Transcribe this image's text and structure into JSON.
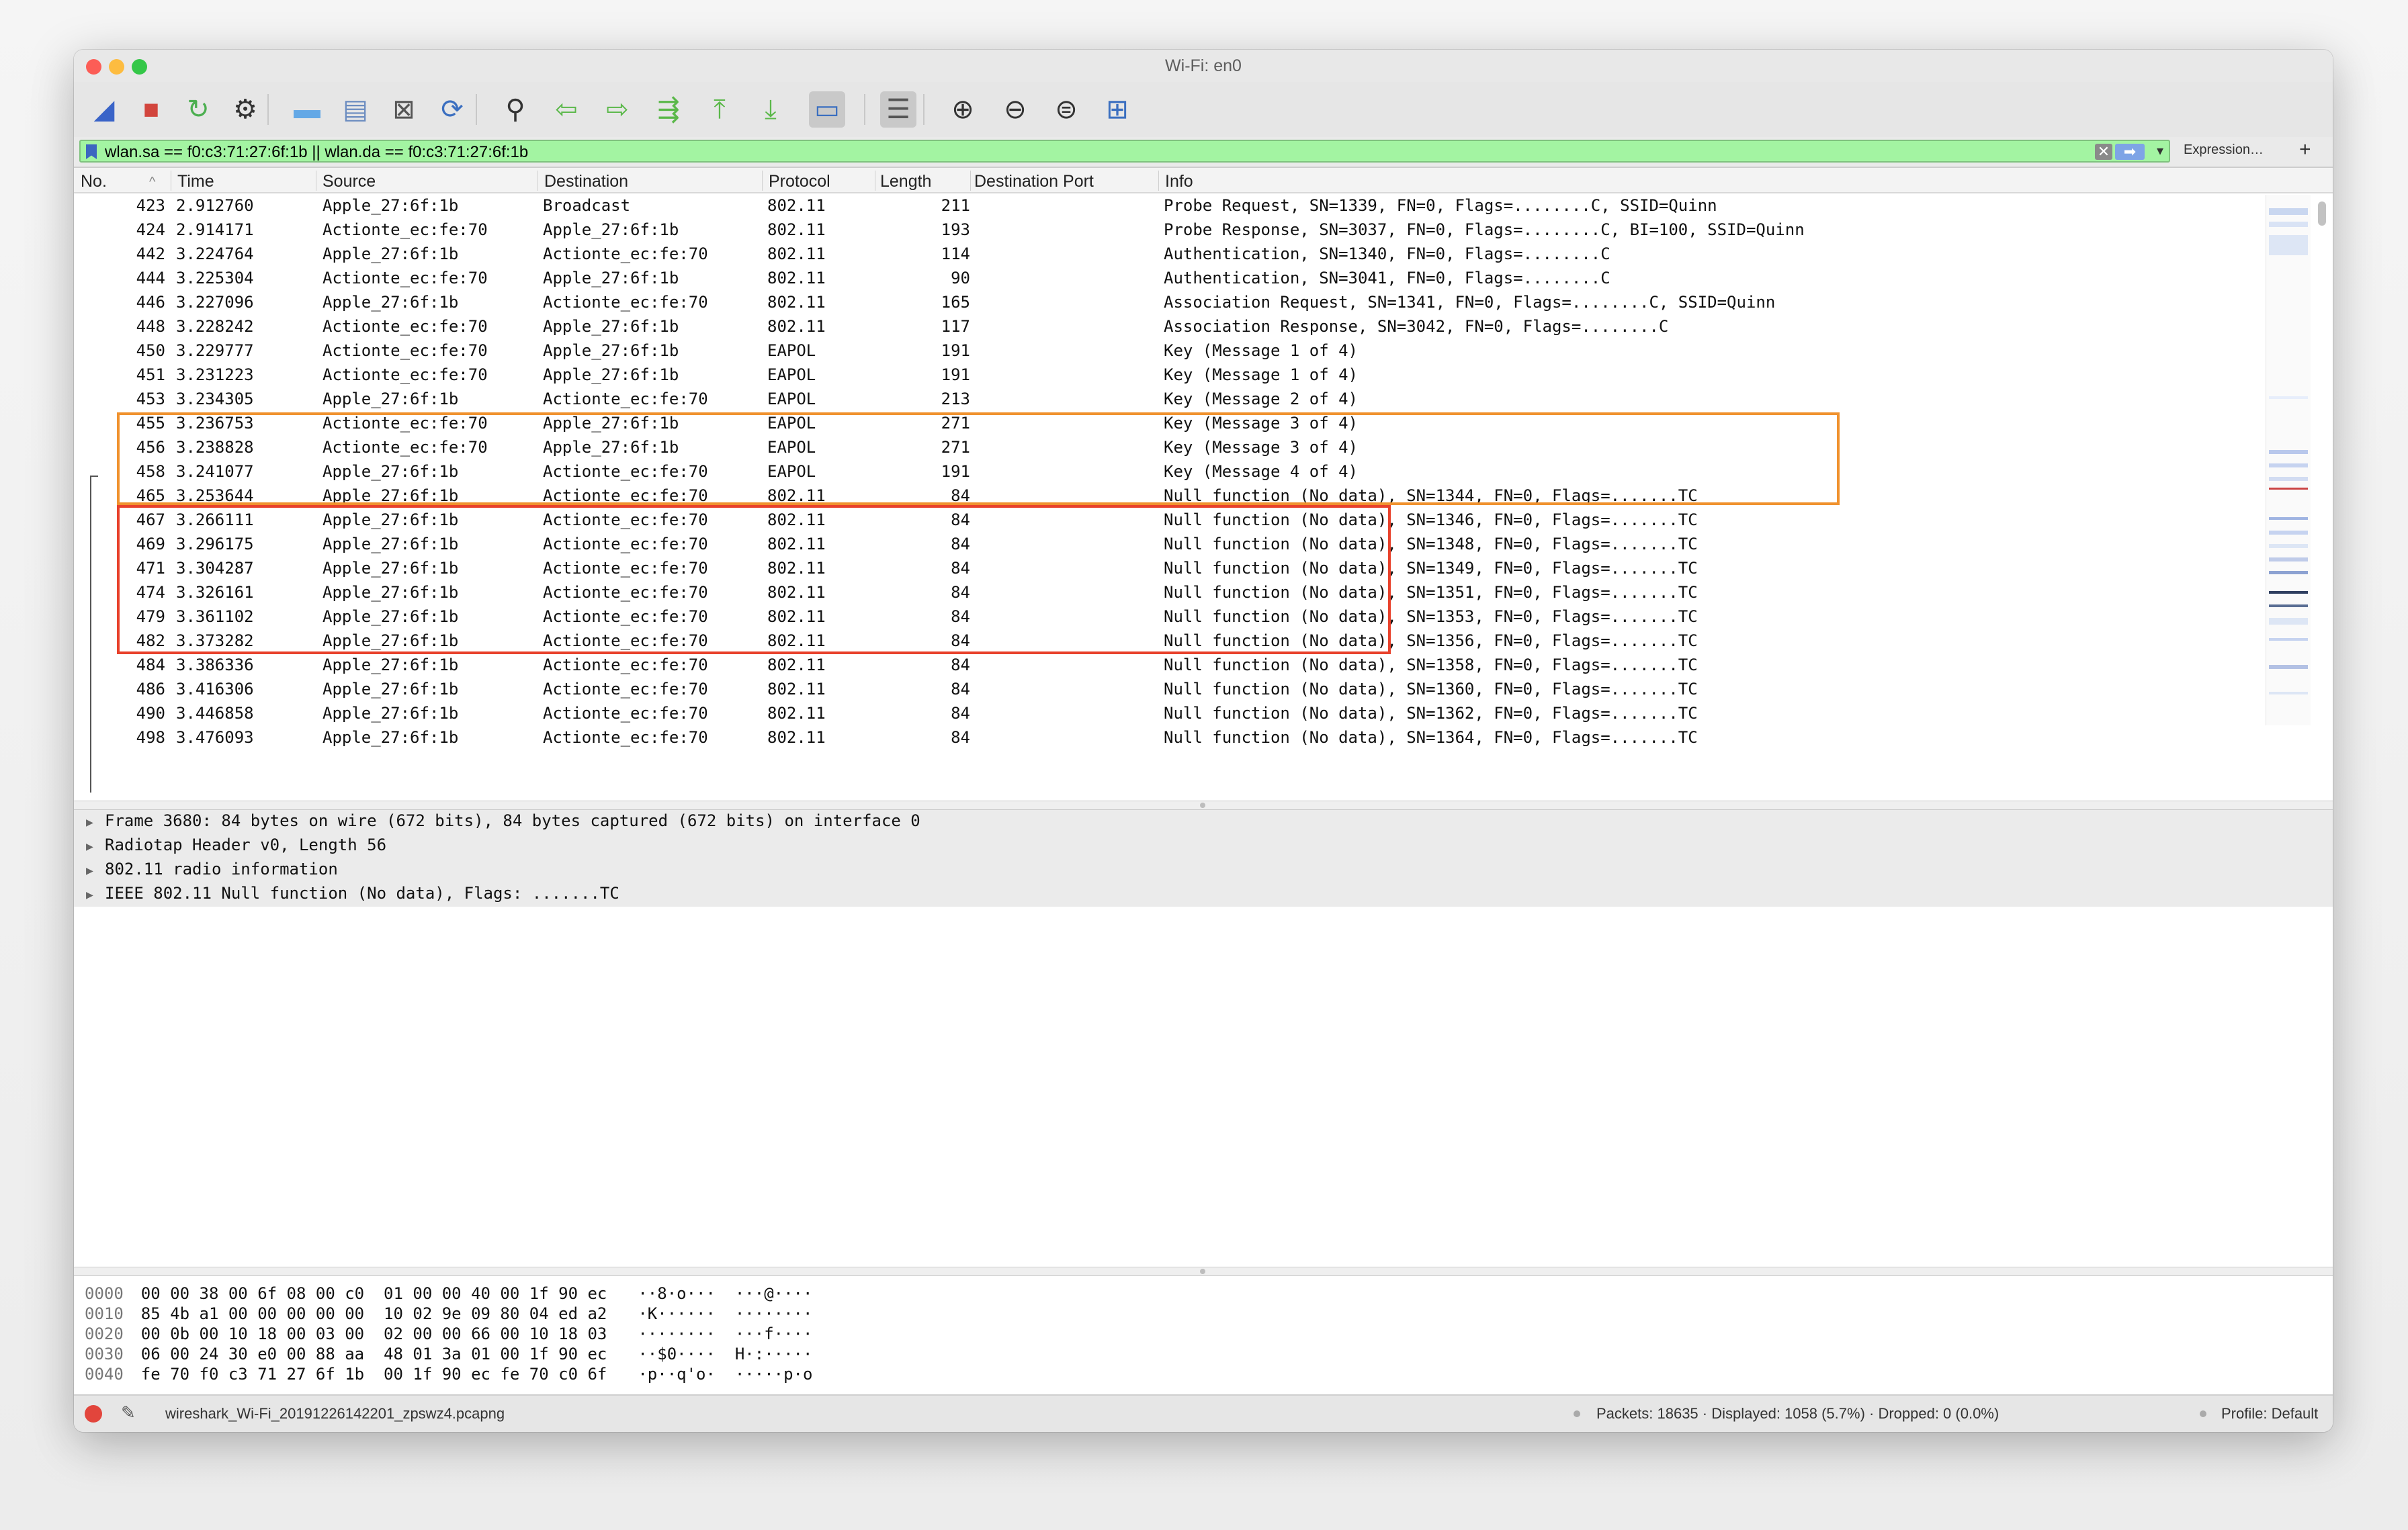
{
  "window": {
    "title": "Wi-Fi: en0"
  },
  "toolbar": {
    "buttons": [
      {
        "icon": "shark-fin-start-icon",
        "glyph": "◢",
        "color": "#3a64c8"
      },
      {
        "icon": "stop-capture-icon",
        "glyph": "■",
        "color": "#d2453d"
      },
      {
        "icon": "restart-capture-icon",
        "glyph": "↻",
        "color": "#4caf50"
      },
      {
        "icon": "capture-options-gear-icon",
        "glyph": "⚙",
        "color": "#333333"
      },
      {
        "icon": "open-folder-icon",
        "glyph": "▬",
        "color": "#63a8e6"
      },
      {
        "icon": "save-file-icon",
        "glyph": "▤",
        "color": "#6b8cc0"
      },
      {
        "icon": "close-file-icon",
        "glyph": "⊠",
        "color": "#555555"
      },
      {
        "icon": "reload-file-icon",
        "glyph": "⟳",
        "color": "#3b6fc0"
      },
      {
        "icon": "find-packet-icon",
        "glyph": "⚲",
        "color": "#333333"
      },
      {
        "icon": "go-back-icon",
        "glyph": "⇦",
        "color": "#5bb84a"
      },
      {
        "icon": "go-forward-icon",
        "glyph": "⇨",
        "color": "#5bb84a"
      },
      {
        "icon": "go-to-packet-icon",
        "glyph": "⇶",
        "color": "#5bb84a"
      },
      {
        "icon": "first-packet-icon",
        "glyph": "⤒",
        "color": "#5bb84a"
      },
      {
        "icon": "last-packet-icon",
        "glyph": "⤓",
        "color": "#5bb84a"
      },
      {
        "icon": "autoscroll-icon",
        "glyph": "▭",
        "color": "#3b6fc0"
      },
      {
        "icon": "colorize-icon",
        "glyph": "☰",
        "color": "#555555"
      },
      {
        "icon": "zoom-in-icon",
        "glyph": "⊕",
        "color": "#333333"
      },
      {
        "icon": "zoom-out-icon",
        "glyph": "⊖",
        "color": "#333333"
      },
      {
        "icon": "normal-size-icon",
        "glyph": "⊜",
        "color": "#333333"
      },
      {
        "icon": "resize-columns-icon",
        "glyph": "⊞",
        "color": "#3b6fc0"
      }
    ]
  },
  "filter": {
    "value": "wlan.sa == f0:c3:71:27:6f:1b || wlan.da == f0:c3:71:27:6f:1b",
    "expression_label": "Expression…",
    "plus_label": "+",
    "clear_label": "✕",
    "apply_label": "➡",
    "dropdown_label": "▾"
  },
  "packet_list": {
    "columns": [
      "No.",
      "Time",
      "Source",
      "Destination",
      "Protocol",
      "Length",
      "Destination Port",
      "Info"
    ],
    "sort_indicator": "^",
    "rows": [
      {
        "no": "423",
        "time": "2.912760",
        "src": "Apple_27:6f:1b",
        "dst": "Broadcast",
        "proto": "802.11",
        "len": "211",
        "info": "Probe Request, SN=1339, FN=0, Flags=........C, SSID=Quinn"
      },
      {
        "no": "424",
        "time": "2.914171",
        "src": "Actionte_ec:fe:70",
        "dst": "Apple_27:6f:1b",
        "proto": "802.11",
        "len": "193",
        "info": "Probe Response, SN=3037, FN=0, Flags=........C, BI=100, SSID=Quinn"
      },
      {
        "no": "442",
        "time": "3.224764",
        "src": "Apple_27:6f:1b",
        "dst": "Actionte_ec:fe:70",
        "proto": "802.11",
        "len": "114",
        "info": "Authentication, SN=1340, FN=0, Flags=........C"
      },
      {
        "no": "444",
        "time": "3.225304",
        "src": "Actionte_ec:fe:70",
        "dst": "Apple_27:6f:1b",
        "proto": "802.11",
        "len": "90",
        "info": "Authentication, SN=3041, FN=0, Flags=........C"
      },
      {
        "no": "446",
        "time": "3.227096",
        "src": "Apple_27:6f:1b",
        "dst": "Actionte_ec:fe:70",
        "proto": "802.11",
        "len": "165",
        "info": "Association Request, SN=1341, FN=0, Flags=........C, SSID=Quinn"
      },
      {
        "no": "448",
        "time": "3.228242",
        "src": "Actionte_ec:fe:70",
        "dst": "Apple_27:6f:1b",
        "proto": "802.11",
        "len": "117",
        "info": "Association Response, SN=3042, FN=0, Flags=........C"
      },
      {
        "no": "450",
        "time": "3.229777",
        "src": "Actionte_ec:fe:70",
        "dst": "Apple_27:6f:1b",
        "proto": "EAPOL",
        "len": "191",
        "info": "Key (Message 1 of 4)"
      },
      {
        "no": "451",
        "time": "3.231223",
        "src": "Actionte_ec:fe:70",
        "dst": "Apple_27:6f:1b",
        "proto": "EAPOL",
        "len": "191",
        "info": "Key (Message 1 of 4)"
      },
      {
        "no": "453",
        "time": "3.234305",
        "src": "Apple_27:6f:1b",
        "dst": "Actionte_ec:fe:70",
        "proto": "EAPOL",
        "len": "213",
        "info": "Key (Message 2 of 4)"
      },
      {
        "no": "455",
        "time": "3.236753",
        "src": "Actionte_ec:fe:70",
        "dst": "Apple_27:6f:1b",
        "proto": "EAPOL",
        "len": "271",
        "info": "Key (Message 3 of 4)"
      },
      {
        "no": "456",
        "time": "3.238828",
        "src": "Actionte_ec:fe:70",
        "dst": "Apple_27:6f:1b",
        "proto": "EAPOL",
        "len": "271",
        "info": "Key (Message 3 of 4)"
      },
      {
        "no": "458",
        "time": "3.241077",
        "src": "Apple_27:6f:1b",
        "dst": "Actionte_ec:fe:70",
        "proto": "EAPOL",
        "len": "191",
        "info": "Key (Message 4 of 4)"
      },
      {
        "no": "465",
        "time": "3.253644",
        "src": "Apple_27:6f:1b",
        "dst": "Actionte_ec:fe:70",
        "proto": "802.11",
        "len": "84",
        "info": "Null function (No data), SN=1344, FN=0, Flags=.......TC"
      },
      {
        "no": "467",
        "time": "3.266111",
        "src": "Apple_27:6f:1b",
        "dst": "Actionte_ec:fe:70",
        "proto": "802.11",
        "len": "84",
        "info": "Null function (No data), SN=1346, FN=0, Flags=.......TC"
      },
      {
        "no": "469",
        "time": "3.296175",
        "src": "Apple_27:6f:1b",
        "dst": "Actionte_ec:fe:70",
        "proto": "802.11",
        "len": "84",
        "info": "Null function (No data), SN=1348, FN=0, Flags=.......TC"
      },
      {
        "no": "471",
        "time": "3.304287",
        "src": "Apple_27:6f:1b",
        "dst": "Actionte_ec:fe:70",
        "proto": "802.11",
        "len": "84",
        "info": "Null function (No data), SN=1349, FN=0, Flags=.......TC"
      },
      {
        "no": "474",
        "time": "3.326161",
        "src": "Apple_27:6f:1b",
        "dst": "Actionte_ec:fe:70",
        "proto": "802.11",
        "len": "84",
        "info": "Null function (No data), SN=1351, FN=0, Flags=.......TC"
      },
      {
        "no": "479",
        "time": "3.361102",
        "src": "Apple_27:6f:1b",
        "dst": "Actionte_ec:fe:70",
        "proto": "802.11",
        "len": "84",
        "info": "Null function (No data), SN=1353, FN=0, Flags=.......TC"
      },
      {
        "no": "482",
        "time": "3.373282",
        "src": "Apple_27:6f:1b",
        "dst": "Actionte_ec:fe:70",
        "proto": "802.11",
        "len": "84",
        "info": "Null function (No data), SN=1356, FN=0, Flags=.......TC"
      },
      {
        "no": "484",
        "time": "3.386336",
        "src": "Apple_27:6f:1b",
        "dst": "Actionte_ec:fe:70",
        "proto": "802.11",
        "len": "84",
        "info": "Null function (No data), SN=1358, FN=0, Flags=.......TC"
      },
      {
        "no": "486",
        "time": "3.416306",
        "src": "Apple_27:6f:1b",
        "dst": "Actionte_ec:fe:70",
        "proto": "802.11",
        "len": "84",
        "info": "Null function (No data), SN=1360, FN=0, Flags=.......TC"
      },
      {
        "no": "490",
        "time": "3.446858",
        "src": "Apple_27:6f:1b",
        "dst": "Actionte_ec:fe:70",
        "proto": "802.11",
        "len": "84",
        "info": "Null function (No data), SN=1362, FN=0, Flags=.......TC"
      },
      {
        "no": "498",
        "time": "3.476093",
        "src": "Apple_27:6f:1b",
        "dst": "Actionte_ec:fe:70",
        "proto": "802.11",
        "len": "84",
        "info": "Null function (No data), SN=1364, FN=0, Flags=.......TC"
      }
    ],
    "highlight_colors": {
      "orange": "#f0922e",
      "red": "#e8412b"
    }
  },
  "details": [
    "Frame 3680: 84 bytes on wire (672 bits), 84 bytes captured (672 bits) on interface 0",
    "Radiotap Header v0, Length 56",
    "802.11 radio information",
    "IEEE 802.11 Null function (No data), Flags: .......TC"
  ],
  "bytes": [
    {
      "offset": "0000",
      "hex": "00 00 38 00 6f 08 00 c0  01 00 00 40 00 1f 90 ec",
      "ascii": "··8·o···  ···@····"
    },
    {
      "offset": "0010",
      "hex": "85 4b a1 00 00 00 00 00  10 02 9e 09 80 04 ed a2",
      "ascii": "·K······  ········"
    },
    {
      "offset": "0020",
      "hex": "00 0b 00 10 18 00 03 00  02 00 00 66 00 10 18 03",
      "ascii": "········  ···f····"
    },
    {
      "offset": "0030",
      "hex": "06 00 24 30 e0 00 88 aa  48 01 3a 01 00 1f 90 ec",
      "ascii": "··$0····  H·:·····"
    },
    {
      "offset": "0040",
      "hex": "fe 70 f0 c3 71 27 6f 1b  00 1f 90 ec fe 70 c0 6f",
      "ascii": "·p··q'o·  ·····p·o"
    }
  ],
  "status": {
    "file": "wireshark_Wi-Fi_20191226142201_zpswz4.pcapng",
    "packets": "Packets: 18635 · Displayed: 1058 (5.7%) · Dropped: 0 (0.0%)",
    "profile": "Profile: Default",
    "edit_glyph": "✎"
  }
}
